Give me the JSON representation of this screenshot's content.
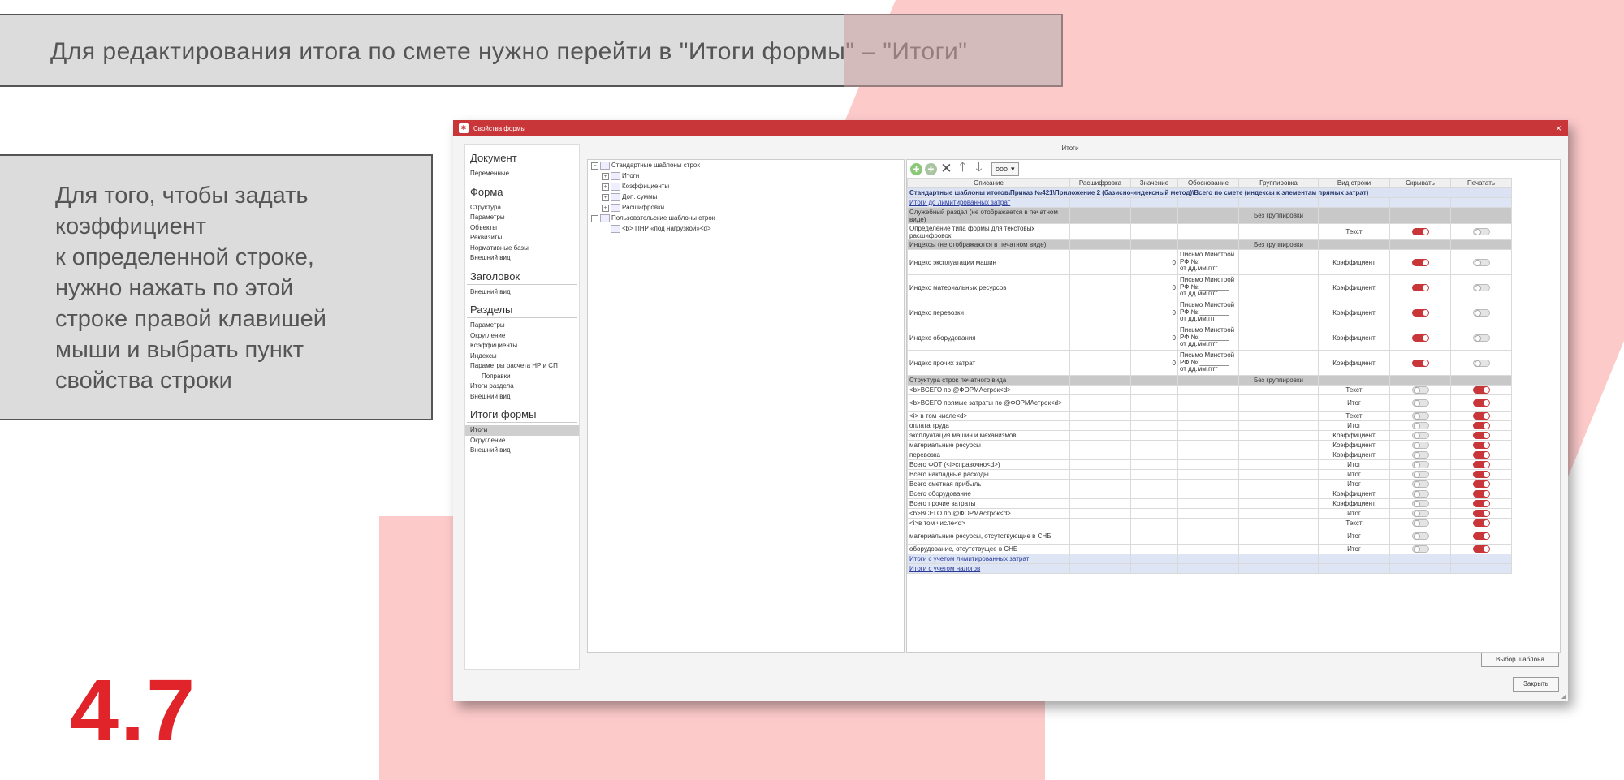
{
  "slide": {
    "title": "Для редактирования итога по смете нужно перейти в \"Итоги формы\" – \"Итоги\"",
    "left_text_lines": [
      "Для того, чтобы задать",
      "коэффициент",
      "к определенной строке,",
      "нужно нажать по этой",
      "строке правой клавишей",
      "мыши и выбрать пункт",
      "свойства строки"
    ],
    "step_number": "4.7",
    "accent_color": "#e1232a",
    "background_accent": "#fdcaca"
  },
  "window": {
    "title": "Свойства формы",
    "app_icon": "app-logo-icon",
    "close_label": "×",
    "title_color": "#c8363a",
    "pane_title": "Итоги"
  },
  "nav": {
    "sections": [
      {
        "header": "Документ",
        "items": [
          {
            "label": "Переменные"
          }
        ]
      },
      {
        "header": "Форма",
        "items": [
          {
            "label": "Структура"
          },
          {
            "label": "Параметры"
          },
          {
            "label": "Объекты"
          },
          {
            "label": "Реквизиты"
          },
          {
            "label": "Нормативные базы"
          },
          {
            "label": "Внешний вид"
          }
        ]
      },
      {
        "header": "Заголовок",
        "items": [
          {
            "label": "Внешний вид"
          }
        ]
      },
      {
        "header": "Разделы",
        "items": [
          {
            "label": "Параметры"
          },
          {
            "label": "Округление"
          },
          {
            "label": "Коэффициенты"
          },
          {
            "label": "Индексы"
          },
          {
            "label": "Параметры расчета НР и СП"
          },
          {
            "label": "Поправки",
            "indent": true
          },
          {
            "label": "Итоги раздела"
          },
          {
            "label": "Внешний вид"
          }
        ]
      },
      {
        "header": "Итоги формы",
        "items": [
          {
            "label": "Итоги",
            "selected": true
          },
          {
            "label": "Округление"
          },
          {
            "label": "Внешний вид"
          }
        ]
      }
    ]
  },
  "tree": {
    "items": [
      {
        "label": "Стандартные шаблоны строк",
        "level": 0,
        "expander": "−"
      },
      {
        "label": "Итоги",
        "level": 1,
        "expander": "+"
      },
      {
        "label": "Коэффициенты",
        "level": 1,
        "expander": "+"
      },
      {
        "label": "Доп. суммы",
        "level": 1,
        "expander": "+"
      },
      {
        "label": "Расшифровки",
        "level": 1,
        "expander": "+"
      },
      {
        "label": "Пользовательские шаблоны строк",
        "level": 0,
        "expander": "−"
      },
      {
        "label": "<b>   ПНР «под нагрузкой»<d>",
        "level": 1,
        "expander": ""
      }
    ]
  },
  "toolbar": {
    "add_icon": "add-icon",
    "add_child_icon": "add-child-icon",
    "delete_icon": "delete-icon",
    "up_icon": "arrow-up-icon",
    "down_icon": "arrow-down-icon",
    "more_label": "ooo",
    "more_chevron": "▾"
  },
  "grid": {
    "columns": [
      "Описание",
      "Расшифровка",
      "Значение",
      "Обоснование",
      "Группировка",
      "Вид строки",
      "Скрывать",
      "Печатать"
    ],
    "rows": [
      {
        "type": "head",
        "desc": "Стандартные шаблоны итогов\\Приказ №421\\Приложение 2 (базисно-индексный метод)\\Всего по смете (индексы к элементам прямых затрат)"
      },
      {
        "type": "link",
        "desc": "Итоги до лимитированных затрат"
      },
      {
        "type": "section",
        "desc": "Служебный раздел (не отображается в печатном виде)",
        "group": "Без группировки"
      },
      {
        "type": "row",
        "desc": "Определение типа формы для текстовых расшифровок",
        "kind": "Текст",
        "hide": true,
        "print": false
      },
      {
        "type": "section",
        "desc": "Индексы (не отображаются в печатном виде)",
        "group": "Без группировки"
      },
      {
        "type": "index",
        "desc": "Индекс эксплуатации машин",
        "value": "0",
        "basis": [
          "Письмо Минстрой",
          "РФ №:________",
          "от дд.мм.гггг"
        ],
        "kind": "Коэффициент",
        "hide": true,
        "print": false
      },
      {
        "type": "index",
        "desc": "Индекс материальных ресурсов",
        "value": "0",
        "basis": [
          "Письмо Минстрой",
          "РФ №:________",
          "от дд.мм.гггг"
        ],
        "kind": "Коэффициент",
        "hide": true,
        "print": false
      },
      {
        "type": "index",
        "desc": "Индекс перевозки",
        "value": "0",
        "basis": [
          "Письмо Минстрой",
          "РФ №:________",
          "от дд.мм.гггг"
        ],
        "kind": "Коэффициент",
        "hide": true,
        "print": false
      },
      {
        "type": "index",
        "desc": "Индекс оборудования",
        "value": "0",
        "basis": [
          "Письмо Минстрой",
          "РФ №:________",
          "от дд.мм.гггг"
        ],
        "kind": "Коэффициент",
        "hide": true,
        "print": false
      },
      {
        "type": "index",
        "desc": "Индекс прочих затрат",
        "value": "0",
        "basis": [
          "Письмо Минстрой",
          "РФ №:________",
          "от дд.мм.гггг"
        ],
        "kind": "Коэффициент",
        "hide": true,
        "print": false
      },
      {
        "type": "section",
        "desc": "Структура строк печатного вида",
        "group": "Без группировки"
      },
      {
        "type": "row",
        "desc": "<b>ВСЕГО по @ФОРМАстрок<d>",
        "kind": "Текст",
        "hide": false,
        "print": true
      },
      {
        "type": "row2",
        "desc": "<b>ВСЕГО прямые затраты по @ФОРМАстрок<d>",
        "kind": "Итог",
        "hide": false,
        "print": true
      },
      {
        "type": "row",
        "desc": "<i>  в том числе<d>",
        "kind": "Текст",
        "hide": false,
        "print": true
      },
      {
        "type": "row",
        "desc": "оплата труда",
        "kind": "Итог",
        "hide": false,
        "print": true
      },
      {
        "type": "row",
        "desc": "эксплуатация машин и механизмов",
        "kind": "Коэффициент",
        "hide": false,
        "print": true
      },
      {
        "type": "row",
        "desc": "материальные ресурсы",
        "kind": "Коэффициент",
        "hide": false,
        "print": true
      },
      {
        "type": "row",
        "desc": "перевозка",
        "kind": "Коэффициент",
        "hide": false,
        "print": true
      },
      {
        "type": "row",
        "desc": "Всего ФОТ (<i>справочно<d>)",
        "kind": "Итог",
        "hide": false,
        "print": true
      },
      {
        "type": "row",
        "desc": "Всего накладные расходы",
        "kind": "Итог",
        "hide": false,
        "print": true
      },
      {
        "type": "row",
        "desc": "Всего сметная прибыль",
        "kind": "Итог",
        "hide": false,
        "print": true
      },
      {
        "type": "row",
        "desc": "Всего оборудование",
        "kind": "Коэффициент",
        "hide": false,
        "print": true
      },
      {
        "type": "row",
        "desc": "Всего прочие затраты",
        "kind": "Коэффициент",
        "hide": false,
        "print": true
      },
      {
        "type": "row",
        "desc": "<b>ВСЕГО по @ФОРМАстрок<d>",
        "kind": "Итог",
        "hide": false,
        "print": true
      },
      {
        "type": "row",
        "desc": "<i>в том числе<d>",
        "kind": "Текст",
        "hide": false,
        "print": true
      },
      {
        "type": "row",
        "desc": "материальные ресурсы, отсутствующие в СНБ",
        "kind": "Итог",
        "hide": false,
        "print": true
      },
      {
        "type": "row",
        "desc": "оборудование, отсутствущее в СНБ",
        "kind": "Итог",
        "hide": false,
        "print": true
      },
      {
        "type": "link",
        "desc": "Итоги с учетом лимитированных затрат"
      },
      {
        "type": "link",
        "desc": "Итоги с учетом налогов"
      }
    ]
  },
  "buttons": {
    "choose_template": "Выбор шаблона",
    "close": "Закрыть"
  }
}
